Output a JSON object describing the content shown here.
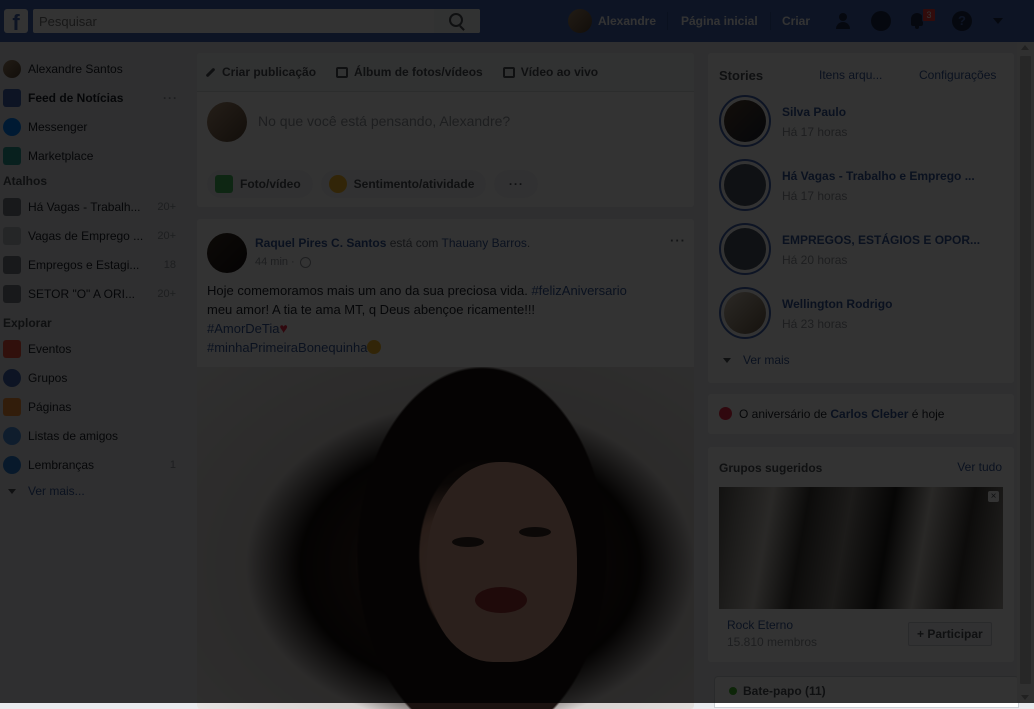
{
  "colors": {
    "brand": "#4267b2",
    "link": "#365899",
    "notification": "#fa3e3e",
    "online": "#42b72a"
  },
  "topbar": {
    "logo_icon": "facebook-f-icon",
    "search_placeholder": "Pesquisar",
    "user_name": "Alexandre",
    "home": "Página inicial",
    "create": "Criar",
    "notification_count": "3"
  },
  "sidebar": {
    "profile_name": "Alexandre Santos",
    "main": [
      {
        "label": "Feed de Notícias",
        "icon": "news-feed-icon",
        "extra": "···"
      },
      {
        "label": "Messenger",
        "icon": "messenger-icon"
      },
      {
        "label": "Marketplace",
        "icon": "marketplace-icon"
      }
    ],
    "shortcuts_title": "Atalhos",
    "shortcuts": [
      {
        "label": "Há Vagas - Trabalh...",
        "count": "20+"
      },
      {
        "label": "Vagas de Emprego ...",
        "count": "20+"
      },
      {
        "label": "Empregos e Estagi...",
        "count": "18"
      },
      {
        "label": "SETOR \"O\" A ORI...",
        "count": "20+"
      }
    ],
    "explore_title": "Explorar",
    "explore": [
      {
        "label": "Eventos",
        "icon": "events-icon",
        "count": ""
      },
      {
        "label": "Grupos",
        "icon": "groups-icon",
        "count": ""
      },
      {
        "label": "Páginas",
        "icon": "pages-icon",
        "count": ""
      },
      {
        "label": "Listas de amigos",
        "icon": "friend-lists-icon",
        "count": ""
      },
      {
        "label": "Lembranças",
        "icon": "memories-icon",
        "count": "1"
      }
    ],
    "see_more": "Ver mais..."
  },
  "composer": {
    "tab_create": "Criar publicação",
    "tab_album": "Álbum de fotos/vídeos",
    "tab_live": "Vídeo ao vivo",
    "placeholder": "No que você está pensando, Alexandre?",
    "action_photo": "Foto/vídeo",
    "action_feeling": "Sentimento/atividade",
    "action_more": "···"
  },
  "post": {
    "author": "Raquel Pires C. Santos",
    "with_text": "está com",
    "tagged": "Thauany Barros",
    "time": "44 min",
    "menu": "···",
    "line1": "Hoje comemoramos mais um ano da sua preciosa vida.",
    "hashtag1": "#felizAniversario",
    "line2": "meu amor! A tia te ama MT, q Deus abençoe ricamente!!!",
    "hashtag2": "#AmorDeTia",
    "hashtag3": "#minhaPrimeiraBonequinha"
  },
  "stories": {
    "title": "Stories",
    "archive": "Itens arqu...",
    "settings": "Configurações",
    "items": [
      {
        "name": "Silva Paulo",
        "time": "Há 17 horas"
      },
      {
        "name": "Há Vagas - Trabalho e Emprego ...",
        "time": "Há 17 horas"
      },
      {
        "name": "EMPREGOS, ESTÁGIOS E OPOR...",
        "time": "Há 20 horas"
      },
      {
        "name": "Wellington Rodrigo",
        "time": "Há 23 horas"
      }
    ],
    "see_more": "Ver mais"
  },
  "birthday": {
    "prefix": "O aniversário de",
    "name": "Carlos Cleber",
    "suffix": "é hoje"
  },
  "groups": {
    "title": "Grupos sugeridos",
    "see_all": "Ver tudo",
    "name": "Rock Eterno",
    "members": "15.810 membros",
    "join": "+ Participar",
    "close": "×"
  },
  "chat": {
    "label": "Bate-papo (11)"
  }
}
